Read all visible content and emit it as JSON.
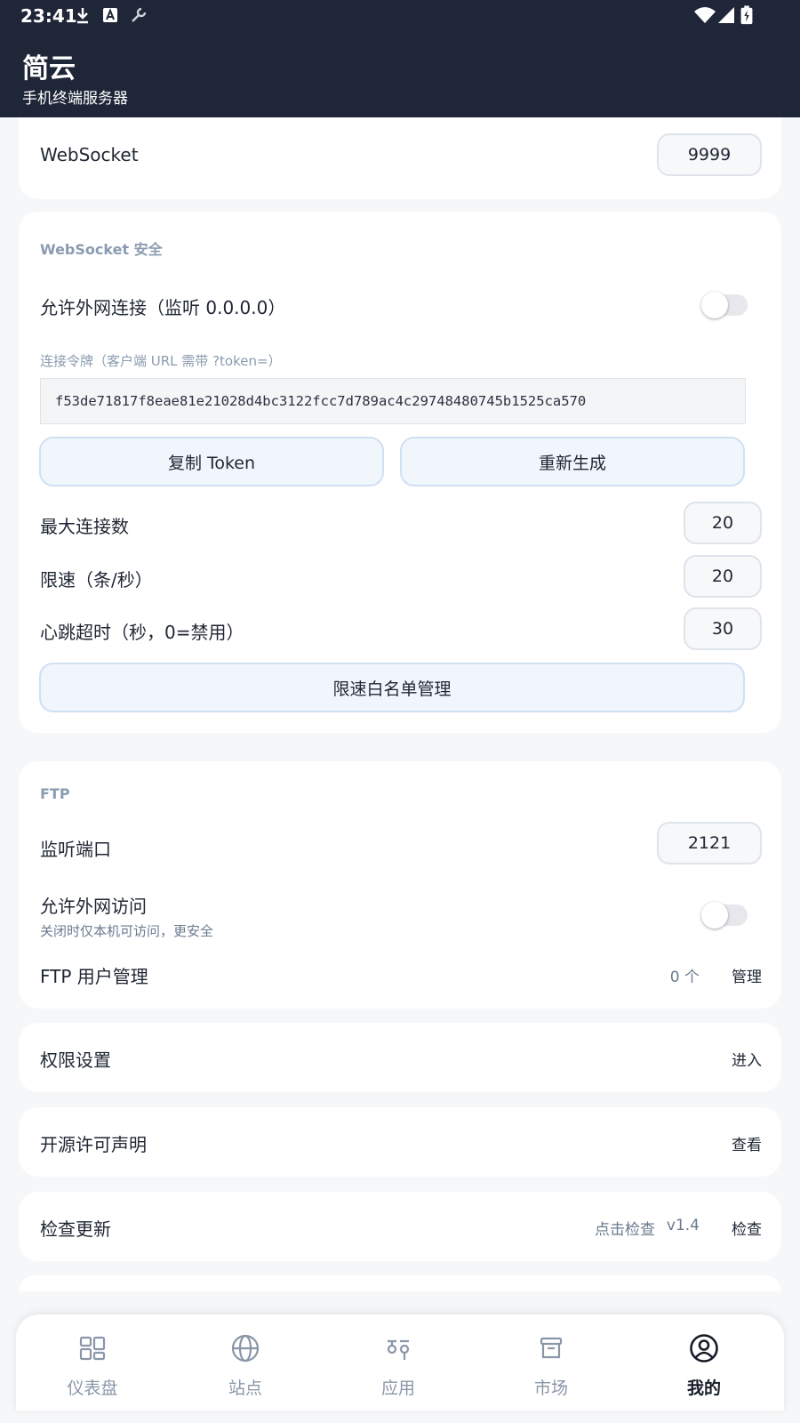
{
  "status_bar": {
    "time": "23:41"
  },
  "app": {
    "title": "简云",
    "subtitle": "手机终端服务器"
  },
  "websocket_port": {
    "label": "WebSocket",
    "value": "9999"
  },
  "websocket_security": {
    "header": "WebSocket 安全",
    "allow_external_label": "允许外网连接（监听 0.0.0.0）",
    "allow_external_on": false,
    "token_label": "连接令牌（客户端 URL 需带 ?token=）",
    "token_value": "f53de71817f8eae81e21028d4bc3122fcc7d789ac4c29748480745b1525ca570",
    "copy_button": "复制 Token",
    "regenerate_button": "重新生成",
    "max_connections_label": "最大连接数",
    "max_connections_value": "20",
    "rate_limit_label": "限速（条/秒）",
    "rate_limit_value": "20",
    "heartbeat_label": "心跳超时（秒，0=禁用）",
    "heartbeat_value": "30",
    "whitelist_button": "限速白名单管理"
  },
  "ftp": {
    "header": "FTP",
    "port_label": "监听端口",
    "port_value": "2121",
    "allow_external_label": "允许外网访问",
    "allow_external_desc": "关闭时仅本机可访问，更安全",
    "allow_external_on": false,
    "users_label": "FTP 用户管理",
    "users_count": "0 个",
    "users_action": "管理"
  },
  "permissions": {
    "label": "权限设置",
    "action": "进入"
  },
  "licenses": {
    "label": "开源许可声明",
    "action": "查看"
  },
  "updates": {
    "label": "检查更新",
    "hint": "点击检查",
    "version": "v1.4",
    "action": "检查"
  },
  "nav": {
    "items": [
      {
        "label": "仪表盘",
        "icon": "dashboard-icon"
      },
      {
        "label": "站点",
        "icon": "globe-icon"
      },
      {
        "label": "应用",
        "icon": "apps-icon"
      },
      {
        "label": "市场",
        "icon": "store-icon"
      },
      {
        "label": "我的",
        "icon": "profile-icon"
      }
    ],
    "active_index": 4
  },
  "colors": {
    "app_bar": "#1e2638",
    "accent_button_bg": "#f1f6fc",
    "accent_button_border": "#cfe0f3",
    "section_header": "#8b9bb0"
  }
}
